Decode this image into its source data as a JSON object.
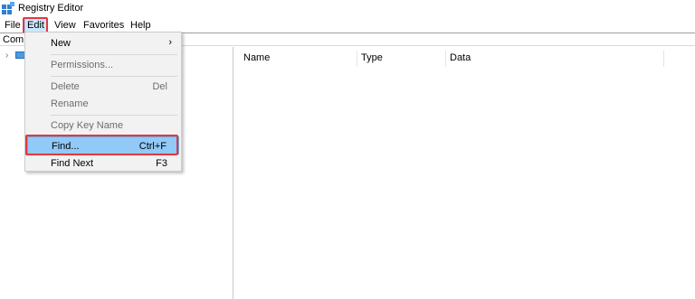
{
  "window": {
    "title": "Registry Editor"
  },
  "menubar": {
    "items": [
      "File",
      "Edit",
      "View",
      "Favorites",
      "Help"
    ]
  },
  "addressbar": {
    "text": "Com"
  },
  "list": {
    "columns": [
      "Name",
      "Type",
      "Data"
    ]
  },
  "edit_menu": {
    "items": [
      {
        "label": "New",
        "shortcut": "",
        "submenu": true,
        "enabled": true
      },
      {
        "label": "Permissions...",
        "shortcut": "",
        "enabled": false
      },
      {
        "label": "Delete",
        "shortcut": "Del",
        "enabled": false
      },
      {
        "label": "Rename",
        "shortcut": "",
        "enabled": false
      },
      {
        "label": "Copy Key Name",
        "shortcut": "",
        "enabled": false
      },
      {
        "label": "Find...",
        "shortcut": "Ctrl+F",
        "enabled": true,
        "highlighted": true
      },
      {
        "label": "Find Next",
        "shortcut": "F3",
        "enabled": true
      }
    ]
  },
  "colors": {
    "highlight_outline": "#e8363c",
    "menu_highlight": "#91c9f7"
  }
}
